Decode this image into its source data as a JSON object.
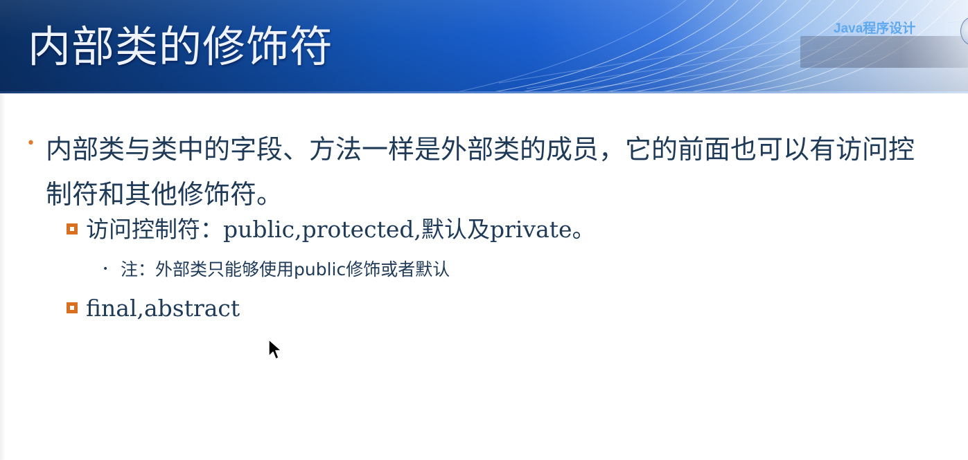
{
  "slide": {
    "title": "内部类的修饰符",
    "course_label": "Java程序设计",
    "colors": {
      "title_text": "#eef3fb",
      "body_text": "#1f3a57",
      "bullet_accent": "#e07a2e",
      "square_accent": "#d9701f",
      "course_label": "#5fa8ee",
      "header_dark": "#0b2f62",
      "header_light": "#e8f0fb"
    }
  },
  "content": {
    "bullet_1": "内部类与类中的字段、方法一样是外部类的成员，它的前面也可以有访问控制符和其他修饰符。",
    "sub_bullets": [
      {
        "text": "访问控制符：public,protected,默认及private。",
        "note": "注：外部类只能够使用public修饰或者默认"
      },
      {
        "text": "final,abstract"
      }
    ]
  },
  "icons": {
    "bullet_marker": "orange-dot",
    "sub_bullet_marker": "orange-hollow-square",
    "note_marker": "small-dot",
    "pointer": "mouse-cursor-arrow",
    "emblem": "university-emblem"
  }
}
